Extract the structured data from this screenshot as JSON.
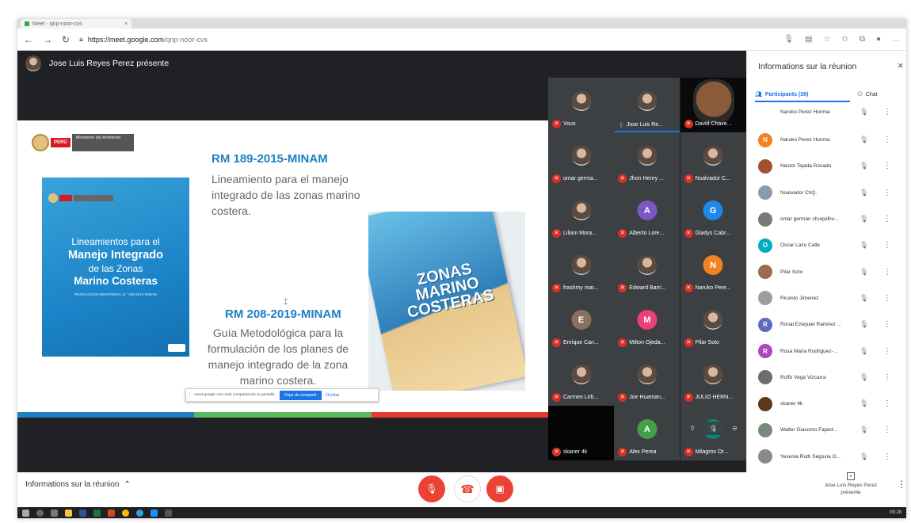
{
  "browser": {
    "tab_title": "Meet - qnp-noor-cvs",
    "tab_close": "×",
    "url_host": "https://meet.google.com",
    "url_path": "/qnp-noor-cvs",
    "back": "←",
    "forward": "→",
    "reload": "↻"
  },
  "presenter": {
    "text": "Jose Luis Reyes Perez présente"
  },
  "slide": {
    "logo": {
      "country": "PERÚ",
      "ministry": "Ministerio del Ambiente"
    },
    "book": {
      "line1": "Lineamientos para el",
      "line2": "Manejo Integrado",
      "line3": "de las Zonas",
      "line4": "Marino Costeras",
      "line5": "RESOLUCIÓN MINISTERIAL N.° 189-2015-MINAM"
    },
    "rm1": "RM 189-2015-MINAM",
    "desc1": "Lineamiento para el manejo integrado de las zonas marino costera.",
    "rm2": "RM 208-2019-MINAM",
    "desc2": "Guía Metodológica para la formulación de los planes de manejo integrado de la zona marino costera.",
    "zona_title": "ZONAS MARINO COSTERAS",
    "band_colors": [
      "#1e7fc1",
      "#5cb85c",
      "#e53935"
    ]
  },
  "share_bar": {
    "text": "meet.google.com está compartiendo tu pantalla.",
    "stop": "Dejar de compartir",
    "hide": "Ocultar"
  },
  "tiles": [
    {
      "name": "Vous",
      "type": "photo",
      "active": false
    },
    {
      "name": "Jose Luis Re...",
      "type": "photo",
      "active": true
    },
    {
      "name": "David Chave...",
      "type": "face",
      "active": false
    },
    {
      "name": "omar germa...",
      "type": "photo",
      "active": false
    },
    {
      "name": "Jhon Henry ...",
      "type": "photo",
      "active": false
    },
    {
      "name": "Nsalvador C...",
      "type": "photo",
      "active": false
    },
    {
      "name": "Liliam Mora...",
      "type": "photo",
      "active": false
    },
    {
      "name": "Alberto Lore...",
      "type": "letter",
      "letter": "A",
      "color": "#7e57c2",
      "active": false
    },
    {
      "name": "Gladys Cabr...",
      "type": "letter",
      "letter": "G",
      "color": "#1e88e5",
      "active": false
    },
    {
      "name": "frashmy mar...",
      "type": "photo",
      "active": false
    },
    {
      "name": "Edward Barri...",
      "type": "photo",
      "active": false
    },
    {
      "name": "Naruko Pere...",
      "type": "letter",
      "letter": "N",
      "color": "#f4811f",
      "active": false
    },
    {
      "name": "Enrique Can...",
      "type": "letter",
      "letter": "E",
      "color": "#8d6e63",
      "active": false
    },
    {
      "name": "Milton Ojeda...",
      "type": "letter",
      "letter": "M",
      "color": "#ec407a",
      "active": false
    },
    {
      "name": "Pilar Soto",
      "type": "photo",
      "active": false
    },
    {
      "name": "Carmen Lirb...",
      "type": "photo",
      "active": false
    },
    {
      "name": "Joe Huaman...",
      "type": "photo",
      "active": false
    },
    {
      "name": "JULIO HERN...",
      "type": "photo",
      "active": false
    },
    {
      "name": "skaner 4k",
      "type": "dark",
      "active": false
    },
    {
      "name": "Alex Perea",
      "type": "letter",
      "letter": "A",
      "color": "#43a047",
      "active": false
    },
    {
      "name": "Milagros Or...",
      "type": "letter",
      "letter": "M",
      "color": "#00897b",
      "active": false
    }
  ],
  "panel": {
    "title": "Informations sur la réunion",
    "close": "×",
    "tab_participants": "Participants (39)",
    "tab_chat": "Chat",
    "participants": [
      {
        "name": "Naruko Perez Honma",
        "letter": "N",
        "color": "#f4811f"
      },
      {
        "name": "Naruko Perez Honma",
        "letter": "N",
        "color": "#f4811f"
      },
      {
        "name": "Nestor Tejada Rosado",
        "letter": "",
        "color": "#a0522d"
      },
      {
        "name": "Nsalvador ChQ.",
        "letter": "",
        "color": "#8a9bb0"
      },
      {
        "name": "omar german chuquilhu...",
        "letter": "",
        "color": "#7a7a7a"
      },
      {
        "name": "Oscar Lazo Calle",
        "letter": "O",
        "color": "#00acc1"
      },
      {
        "name": "Pilar Soto",
        "letter": "",
        "color": "#9c6b4f"
      },
      {
        "name": "Ricardo Jimenez",
        "letter": "",
        "color": "#9e9e9e"
      },
      {
        "name": "Ronal Ezequiel Ramirez ...",
        "letter": "R",
        "color": "#5c6bc0"
      },
      {
        "name": "Rosa Maria Rodriguez-...",
        "letter": "R",
        "color": "#ab47bc"
      },
      {
        "name": "Ruffo Vega Vizcarra",
        "letter": "",
        "color": "#6d6d6d"
      },
      {
        "name": "skaner 4k",
        "letter": "",
        "color": "#5a3a1a"
      },
      {
        "name": "Walter Giacomo Fajard...",
        "letter": "",
        "color": "#7a8a7a"
      },
      {
        "name": "Yesenia Ruth Segovia O...",
        "letter": "",
        "color": "#8a8a8a"
      }
    ]
  },
  "bottom": {
    "meeting_details": "Informations sur la réunion",
    "presenting": "Jose Luis Reyes Perez présente",
    "clock": "09:28"
  }
}
